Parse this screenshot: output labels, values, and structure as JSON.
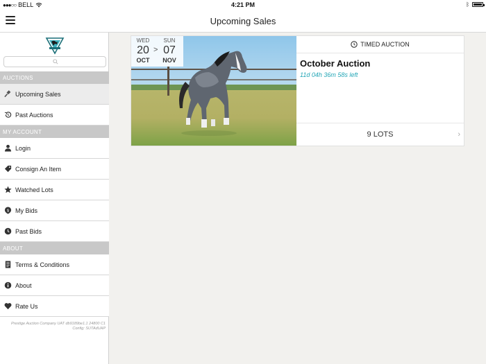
{
  "status_bar": {
    "carrier": "BELL",
    "time": "4:21 PM"
  },
  "nav": {
    "title": "Upcoming Sales"
  },
  "sidebar": {
    "search": {
      "placeholder": ""
    },
    "sections": {
      "auctions": "AUCTIONS",
      "account": "MY ACCOUNT",
      "about": "ABOUT"
    },
    "items": {
      "upcoming": "Upcoming Sales",
      "past_auctions": "Past Auctions",
      "login": "Login",
      "consign": "Consign An Item",
      "watched": "Watched Lots",
      "my_bids": "My Bids",
      "past_bids": "Past Bids",
      "terms": "Terms & Conditions",
      "about": "About",
      "rate": "Rate Us"
    },
    "footer_line1": "Prestige Auction Company UAT db9189be1.1 24800 C1",
    "footer_line2": "Config: SUTAdUAP"
  },
  "sale": {
    "start": {
      "dow": "WED",
      "day": "20",
      "month": "OCT"
    },
    "separator": ">",
    "end": {
      "dow": "SUN",
      "day": "07",
      "month": "NOV"
    },
    "type": "TIMED AUCTION",
    "name": "October Auction",
    "countdown": "11d 04h 36m 58s left",
    "lots": "9 LOTS",
    "chevron": "›"
  },
  "colors": {
    "accent": "#23a6b6",
    "section_bg": "#c8c8c8"
  },
  "icons": [
    "hamburger-icon",
    "search-icon",
    "gavel-icon",
    "history-icon",
    "user-icon",
    "tag-icon",
    "star-icon",
    "bid-icon",
    "clock-icon",
    "document-icon",
    "info-icon",
    "heart-icon",
    "chevron-right-icon"
  ]
}
